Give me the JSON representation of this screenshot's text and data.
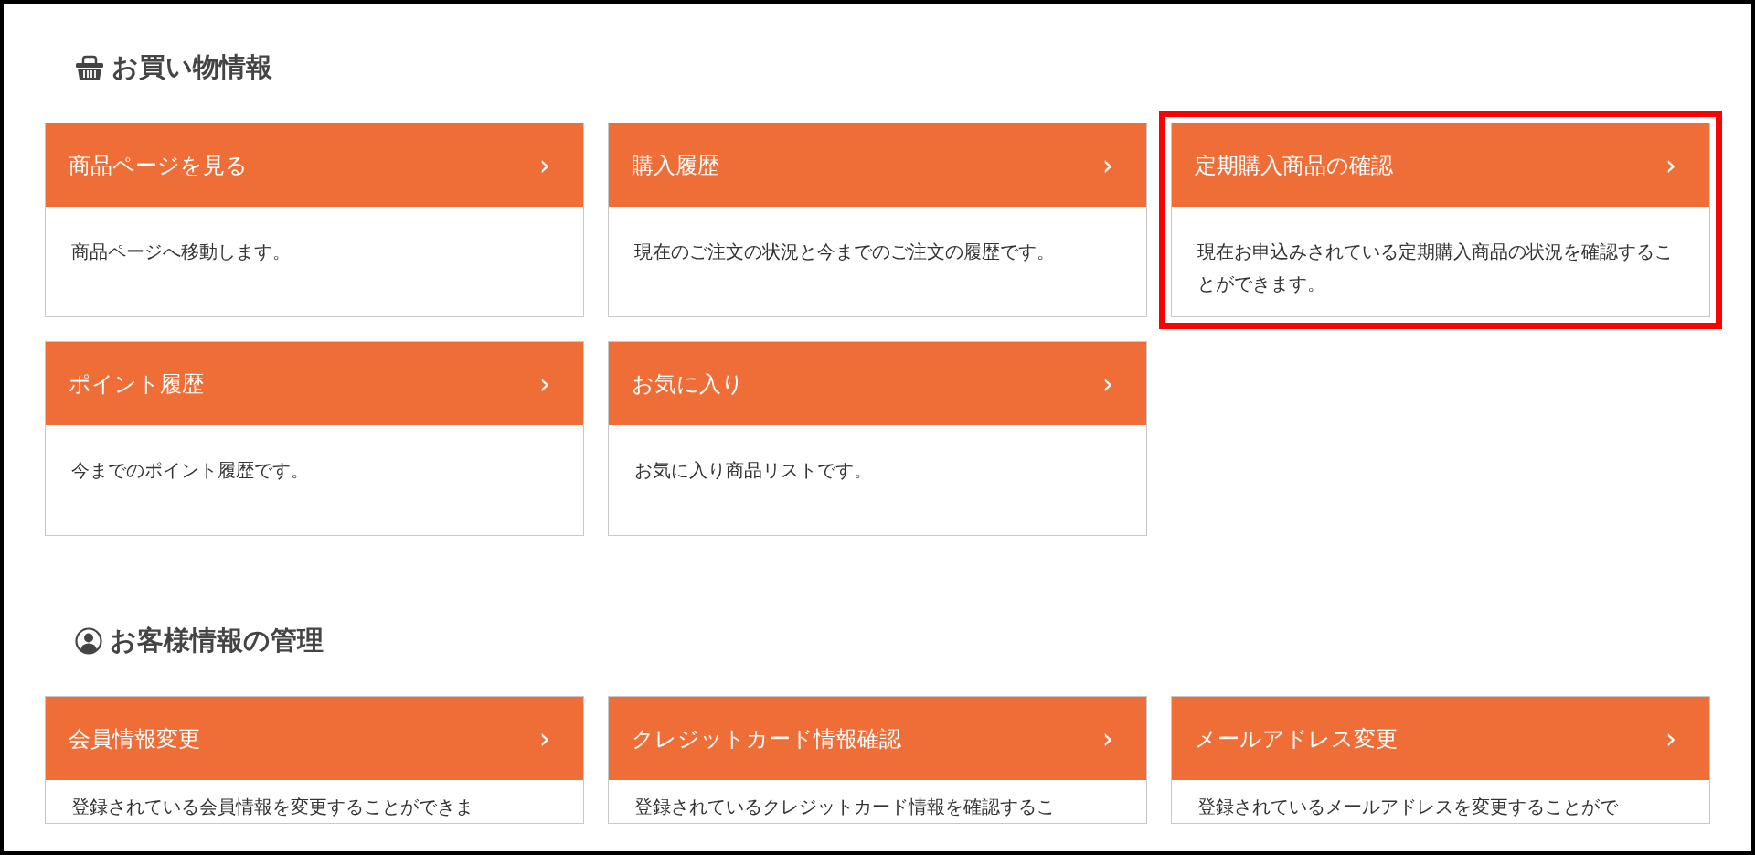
{
  "sections": [
    {
      "kind": "basket",
      "title": "お買い物情報",
      "cards": [
        {
          "title": "商品ページを見る",
          "arrow": "›",
          "description": "商品ページへ移動します。",
          "highlighted": false
        },
        {
          "title": "購入履歴",
          "arrow": "›",
          "description": "現在のご注文の状況と今までのご注文の履歴です。",
          "highlighted": false
        },
        {
          "title": "定期購入商品の確認",
          "arrow": "›",
          "description": "現在お申込みされている定期購入商品の状況を確認することができます。",
          "highlighted": true
        },
        {
          "title": "ポイント履歴",
          "arrow": "›",
          "description": "今までのポイント履歴です。",
          "highlighted": false
        },
        {
          "title": "お気に入り",
          "arrow": "›",
          "description": "お気に入り商品リストです。",
          "highlighted": false
        }
      ]
    },
    {
      "kind": "user",
      "title": "お客様情報の管理",
      "cards": [
        {
          "title": "会員情報変更",
          "arrow": "›",
          "description": "登録されている会員情報を変更することができま",
          "highlighted": false
        },
        {
          "title": "クレジットカード情報確認",
          "arrow": "›",
          "description": "登録されているクレジットカード情報を確認するこ",
          "highlighted": false
        },
        {
          "title": "メールアドレス変更",
          "arrow": "›",
          "description": "登録されているメールアドレスを変更することがで",
          "highlighted": false
        }
      ]
    }
  ]
}
